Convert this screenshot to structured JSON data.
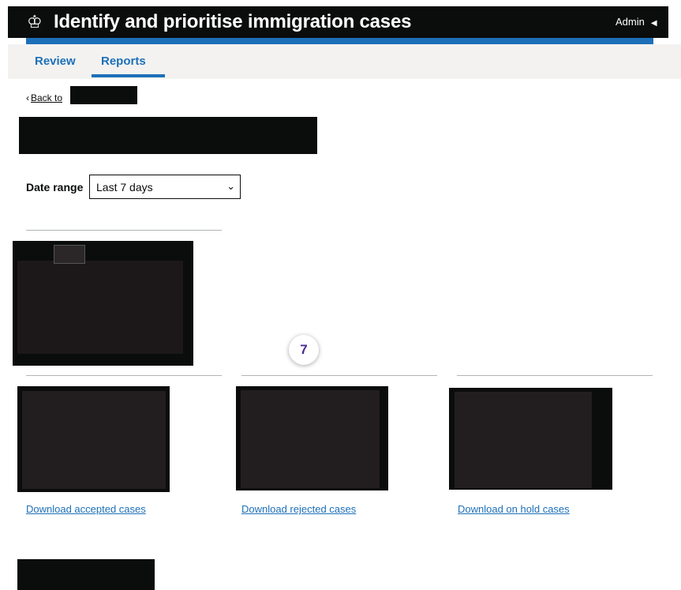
{
  "header": {
    "crown_icon": "crown-icon",
    "title": "Identify and prioritise immigration cases",
    "user": "Admin",
    "user_caret": "◀"
  },
  "nav": {
    "tabs": [
      {
        "label": "Review"
      },
      {
        "label": "Reports",
        "active": true
      }
    ]
  },
  "back_link": {
    "label": "Back to"
  },
  "filters": {
    "date_range_label": "Date range",
    "date_range_value": "Last 7 days"
  },
  "step_marker": "7",
  "downloads": {
    "accepted": "Download accepted cases",
    "rejected": "Download rejected cases",
    "on_hold": "Download on hold cases"
  },
  "colors": {
    "header_bg": "#0b0c0c",
    "accent_blue": "#1d70b8",
    "nav_bg": "#f3f2f1",
    "badge_text": "#4c2c92"
  }
}
